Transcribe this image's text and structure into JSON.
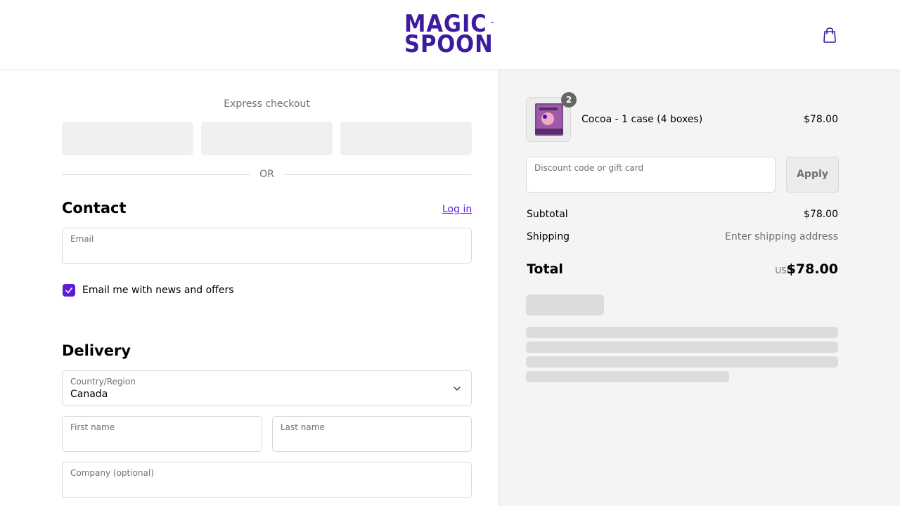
{
  "header": {
    "logo_line1": "MAGIC",
    "logo_line2": "SPOON",
    "logo_tm": "™",
    "cart_icon": "shopping-bag-icon"
  },
  "express": {
    "title": "Express checkout",
    "or": "OR"
  },
  "contact": {
    "heading": "Contact",
    "login_label": "Log in",
    "email_label": "Email",
    "newsletter_label": "Email me with news and offers",
    "newsletter_checked": true
  },
  "delivery": {
    "heading": "Delivery",
    "country_label": "Country/Region",
    "country_value": "Canada",
    "first_name_label": "First name",
    "last_name_label": "Last name",
    "company_label": "Company (optional)"
  },
  "summary": {
    "item_quantity": "2",
    "item_name": "Cocoa - 1 case (4 boxes)",
    "item_price": "$78.00",
    "discount_placeholder": "Discount code or gift card",
    "apply_label": "Apply",
    "subtotal_label": "Subtotal",
    "subtotal_value": "$78.00",
    "shipping_label": "Shipping",
    "shipping_value": "Enter shipping address",
    "total_label": "Total",
    "currency": "USD",
    "total_value": "$78.00"
  },
  "colors": {
    "brand": "#3d1a9e",
    "accent": "#5c1cd8"
  }
}
